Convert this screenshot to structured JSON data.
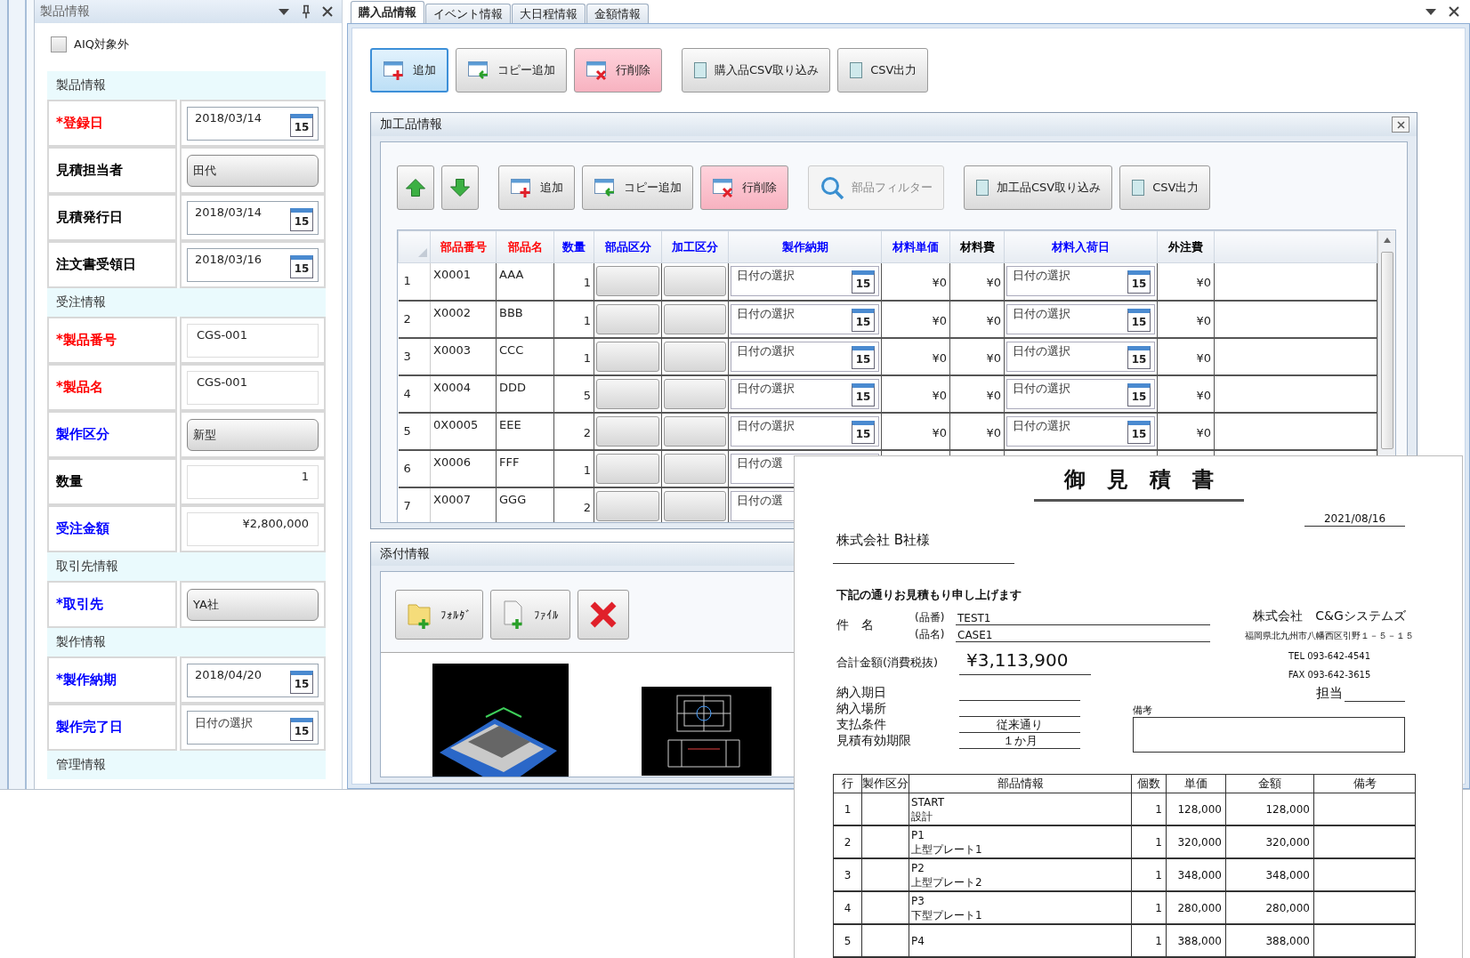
{
  "left_panel": {
    "title": "製品情報",
    "checkbox": {
      "label": "AIQ対象外",
      "checked": false
    },
    "sections": [
      {
        "title": "製品情報",
        "rows": [
          {
            "label": "*登録日",
            "color": "#ff0000",
            "kind": "date",
            "value": "2018/03/14",
            "icon_text": "15"
          },
          {
            "label": "見積担当者",
            "color": "#000000",
            "kind": "combo",
            "value": "田代"
          },
          {
            "label": "見積発行日",
            "color": "#000000",
            "kind": "date",
            "value": "2018/03/14",
            "icon_text": "15"
          },
          {
            "label": "注文書受領日",
            "color": "#000000",
            "kind": "date",
            "value": "2018/03/16",
            "icon_text": "15"
          }
        ]
      },
      {
        "title": "受注情報",
        "rows": [
          {
            "label": "*製品番号",
            "color": "#ff0000",
            "kind": "text",
            "value": "CGS-001"
          },
          {
            "label": "*製品名",
            "color": "#ff0000",
            "kind": "text",
            "value": "CGS-001"
          },
          {
            "label": "製作区分",
            "color": "#0000ff",
            "kind": "combo",
            "value": "新型"
          },
          {
            "label": "数量",
            "color": "#000000",
            "kind": "number",
            "value": "1"
          },
          {
            "label": "受注金額",
            "color": "#0000ff",
            "kind": "number",
            "value": "¥2,800,000"
          }
        ]
      },
      {
        "title": "取引先情報",
        "rows": [
          {
            "label": "*取引先",
            "color": "#0000ff",
            "kind": "combo",
            "value": "YA社"
          }
        ]
      },
      {
        "title": "製作情報",
        "rows": [
          {
            "label": "*製作納期",
            "color": "#0000ff",
            "kind": "date",
            "value": "2018/04/20",
            "icon_text": "15"
          },
          {
            "label": "製作完了日",
            "color": "#0000ff",
            "kind": "date",
            "placeholder": "日付の選択",
            "icon_text": "15"
          }
        ]
      },
      {
        "title": "管理情報"
      }
    ]
  },
  "main": {
    "tabs": [
      {
        "label": "購入品情報",
        "selected": true
      },
      {
        "label": "イベント情報",
        "selected": false
      },
      {
        "label": "大日程情報",
        "selected": false
      },
      {
        "label": "金額情報",
        "selected": false
      }
    ],
    "toolbar": [
      {
        "kind": "add",
        "label": "追加",
        "focused": true
      },
      {
        "kind": "copy",
        "label": "コピー追加",
        "focused": false
      },
      {
        "kind": "delete",
        "label": "行削除",
        "focused": false
      },
      {
        "kind": "import",
        "label": "購入品CSV取り込み",
        "focused": false
      },
      {
        "kind": "export",
        "label": "CSV出力",
        "focused": false
      }
    ],
    "parts_window": {
      "title": "加工品情報",
      "toolbar": [
        {
          "kind": "up",
          "disabled": false
        },
        {
          "kind": "down",
          "disabled": false
        },
        {
          "kind": "add",
          "label": "追加",
          "disabled": false
        },
        {
          "kind": "copy",
          "label": "コピー追加",
          "disabled": false
        },
        {
          "kind": "delete",
          "label": "行削除",
          "disabled": false
        },
        {
          "kind": "filter",
          "label": "部品フィルター",
          "disabled": true
        },
        {
          "kind": "import",
          "label": "加工品CSV取り込み",
          "disabled": false
        },
        {
          "kind": "export",
          "label": "CSV出力",
          "disabled": false
        }
      ],
      "grid": {
        "columns": [
          {
            "label": "部品番号",
            "color": "#ff0000"
          },
          {
            "label": "部品名",
            "color": "#ff0000"
          },
          {
            "label": "数量",
            "color": "#0000ff"
          },
          {
            "label": "部品区分",
            "color": "#0000ff"
          },
          {
            "label": "加工区分",
            "color": "#0000ff"
          },
          {
            "label": "製作納期",
            "color": "#0000ff"
          },
          {
            "label": "材料単価",
            "color": "#0000ff"
          },
          {
            "label": "材料費",
            "color": "#000000"
          },
          {
            "label": "材料入荷日",
            "color": "#0000ff"
          },
          {
            "label": "外注費",
            "color": "#000000"
          }
        ],
        "rows": [
          {
            "no": "1",
            "part_no": "X0001",
            "name": "AAA",
            "qty": "1",
            "delivery": {
              "placeholder": "日付の選択",
              "icon_text": "15"
            },
            "material_price": "¥0",
            "material_cost": "¥0",
            "arrival": {
              "placeholder": "日付の選択",
              "icon_text": "15"
            },
            "outsourcing": "¥0"
          },
          {
            "no": "2",
            "part_no": "X0002",
            "name": "BBB",
            "qty": "1",
            "delivery": {
              "placeholder": "日付の選択",
              "icon_text": "15"
            },
            "material_price": "¥0",
            "material_cost": "¥0",
            "arrival": {
              "placeholder": "日付の選択",
              "icon_text": "15"
            },
            "outsourcing": "¥0"
          },
          {
            "no": "3",
            "part_no": "X0003",
            "name": "CCC",
            "qty": "1",
            "delivery": {
              "placeholder": "日付の選択",
              "icon_text": "15"
            },
            "material_price": "¥0",
            "material_cost": "¥0",
            "arrival": {
              "placeholder": "日付の選択",
              "icon_text": "15"
            },
            "outsourcing": "¥0"
          },
          {
            "no": "4",
            "part_no": "X0004",
            "name": "DDD",
            "qty": "5",
            "delivery": {
              "placeholder": "日付の選択",
              "icon_text": "15"
            },
            "material_price": "¥0",
            "material_cost": "¥0",
            "arrival": {
              "placeholder": "日付の選択",
              "icon_text": "15"
            },
            "outsourcing": "¥0"
          },
          {
            "no": "5",
            "part_no": "0X0005",
            "name": "EEE",
            "qty": "2",
            "delivery": {
              "placeholder": "日付の選択",
              "icon_text": "15"
            },
            "material_price": "¥0",
            "material_cost": "¥0",
            "arrival": {
              "placeholder": "日付の選択",
              "icon_text": "15"
            },
            "outsourcing": "¥0"
          },
          {
            "no": "6",
            "part_no": "X0006",
            "name": "FFF",
            "qty": "1",
            "delivery": {
              "placeholder": "日付の選"
            }
          },
          {
            "no": "7",
            "part_no": "X0007",
            "name": "GGG",
            "qty": "2",
            "delivery": {
              "placeholder": "日付の選"
            }
          }
        ]
      }
    },
    "attachments": {
      "title": "添付情報",
      "toolbar": [
        {
          "kind": "folder",
          "label": "ﾌｫﾙﾀﾞ"
        },
        {
          "kind": "file",
          "label": "ﾌｧｲﾙ"
        },
        {
          "kind": "remove"
        }
      ],
      "images": [
        {
          "kind": "cad_model"
        },
        {
          "kind": "cad_drawing"
        }
      ]
    }
  },
  "estimate": {
    "title": "御　見　積　書",
    "date": "2021/08/16",
    "addressee": "株式会社 B社様",
    "intro": "下記の通りお見積もり申し上げます",
    "subject_label": "件　名",
    "subject": [
      {
        "tag": "(品番)",
        "value": "TEST1"
      },
      {
        "tag": "(品名)",
        "value": "CASE1"
      }
    ],
    "total_label": "合計金額(消費税抜)",
    "total": "¥3,113,900",
    "company": {
      "name": "株式会社　C&Gシステムズ",
      "address": "福岡県北九州市八幡西区引野１－５－１５",
      "tel": "TEL 093-642-4541",
      "fax": "FAX 093-642-3615"
    },
    "staff_label": "担当",
    "terms": [
      {
        "label": "納入期日"
      },
      {
        "label": "納入場所"
      },
      {
        "label": "支払条件",
        "value": "従来通り"
      },
      {
        "label": "見積有効期限",
        "value": "１か月"
      }
    ],
    "remarks_label": "備考",
    "table": {
      "columns": [
        "行",
        "製作区分",
        "部品情報",
        "個数",
        "単価",
        "金額",
        "備考"
      ],
      "rows": [
        {
          "no": "1",
          "part": [
            "START",
            "設計"
          ],
          "qty": "1",
          "price": "128,000",
          "amount": "128,000"
        },
        {
          "no": "2",
          "part": [
            "P1",
            "上型プレート1"
          ],
          "qty": "1",
          "price": "320,000",
          "amount": "320,000"
        },
        {
          "no": "3",
          "part": [
            "P2",
            "上型プレート2"
          ],
          "qty": "1",
          "price": "348,000",
          "amount": "348,000"
        },
        {
          "no": "4",
          "part": [
            "P3",
            "下型プレート1"
          ],
          "qty": "1",
          "price": "280,000",
          "amount": "280,000"
        },
        {
          "no": "5",
          "part": [
            "P4"
          ],
          "qty": "1",
          "price": "388,000",
          "amount": "388,000"
        }
      ]
    }
  }
}
